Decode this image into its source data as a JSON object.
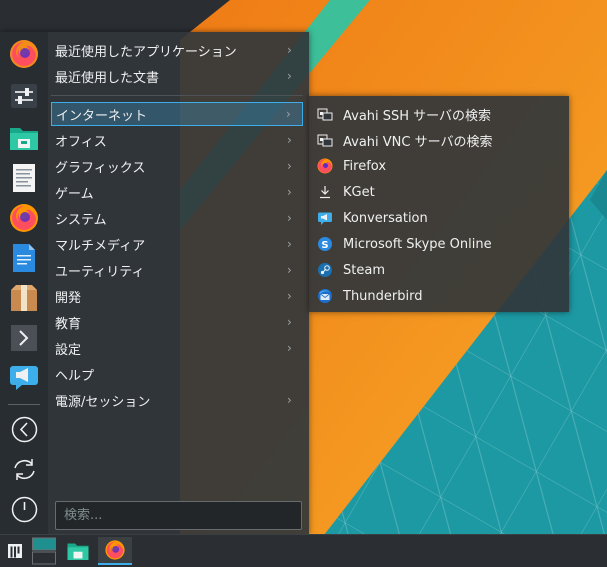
{
  "colors": {
    "accent": "#3daee9",
    "menu_bg": "#31363b",
    "wallpaper_orange": "#f39c1f",
    "wallpaper_teal": "#1d99a3",
    "wallpaper_dark": "#2a2e32"
  },
  "favorites": [
    {
      "name": "firefox",
      "icon": "firefox-icon"
    },
    {
      "name": "system-settings",
      "icon": "settings-sliders-icon"
    },
    {
      "name": "file-manager",
      "icon": "folder-icon"
    },
    {
      "name": "text-editor",
      "icon": "text-document-icon"
    },
    {
      "name": "firefox-2",
      "icon": "firefox-icon"
    },
    {
      "name": "office-writer",
      "icon": "document-icon"
    },
    {
      "name": "package-manager",
      "icon": "package-box-icon"
    },
    {
      "name": "terminal",
      "icon": "terminal-icon"
    },
    {
      "name": "konversation",
      "icon": "chat-megaphone-icon"
    }
  ],
  "system_actions": [
    {
      "name": "lock-screen",
      "icon": "back-arrow-circle-icon"
    },
    {
      "name": "switch-user",
      "icon": "refresh-circle-icon"
    },
    {
      "name": "shutdown",
      "icon": "power-icon"
    }
  ],
  "menu": {
    "recent": [
      {
        "label": "最近使用したアプリケーション"
      },
      {
        "label": "最近使用した文書"
      }
    ],
    "categories": [
      {
        "label": "インターネット",
        "has_submenu": true,
        "active": true
      },
      {
        "label": "オフィス",
        "has_submenu": true
      },
      {
        "label": "グラフィックス",
        "has_submenu": true
      },
      {
        "label": "ゲーム",
        "has_submenu": true
      },
      {
        "label": "システム",
        "has_submenu": true
      },
      {
        "label": "マルチメディア",
        "has_submenu": true
      },
      {
        "label": "ユーティリティ",
        "has_submenu": true
      },
      {
        "label": "開発",
        "has_submenu": true
      },
      {
        "label": "教育",
        "has_submenu": true
      },
      {
        "label": "設定",
        "has_submenu": true
      },
      {
        "label": "ヘルプ",
        "has_submenu": false
      },
      {
        "label": "電源/セッション",
        "has_submenu": true
      }
    ],
    "search_placeholder": "検索..."
  },
  "submenu": {
    "items": [
      {
        "label": "Avahi SSH サーバの検索",
        "icon": "network-remote-icon"
      },
      {
        "label": "Avahi VNC サーバの検索",
        "icon": "network-remote-icon"
      },
      {
        "label": "Firefox",
        "icon": "firefox-icon"
      },
      {
        "label": "KGet",
        "icon": "download-icon"
      },
      {
        "label": "Konversation",
        "icon": "chat-megaphone-icon"
      },
      {
        "label": "Microsoft Skype Online",
        "icon": "skype-icon"
      },
      {
        "label": "Steam",
        "icon": "steam-icon"
      },
      {
        "label": "Thunderbird",
        "icon": "thunderbird-icon"
      }
    ]
  },
  "taskbar": {
    "items": [
      {
        "name": "application-launcher",
        "icon": "launcher-icon"
      },
      {
        "name": "pager",
        "icon": "desktop-pager-icon"
      },
      {
        "name": "file-manager-task",
        "icon": "folder-icon"
      },
      {
        "name": "firefox-task",
        "icon": "firefox-icon"
      }
    ]
  }
}
